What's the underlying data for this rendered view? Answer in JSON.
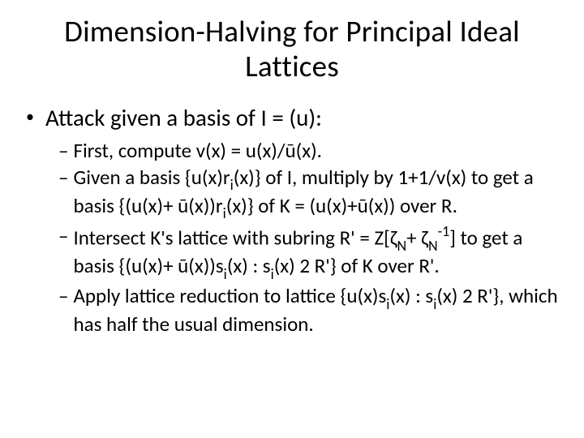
{
  "title": "Dimension-Halving for Principal Ideal Lattices",
  "bullet1_prefix": "Attack given a basis of I = (",
  "bullet1_u": "u",
  "bullet1_suffix": "):",
  "sub1_prefix": "First, compute v(x) = ",
  "sub1_mid": "u(x)/ū(x).",
  "sub2_a": "Given a basis {u(x)r",
  "sub2_b": "(x)} of I, multiply by 1+1/v(x) to get a basis {(u(x)+ ū(x))r",
  "sub2_c": "(x)} of K = (u(x)+ū(x)) over R.",
  "sub3_a": "Intersect K's lattice with subring R' = Z[ζ",
  "sub3_b": "+ ζ",
  "sub3_c": "] to get a basis {(u(x)+ ū(x))s",
  "sub3_d": "(x) : s",
  "sub3_e": "(x) ",
  "sub3_f": " R'} of K over R'.",
  "sub4_a": "Apply lattice reduction to lattice {u(x)s",
  "sub4_b": "(x) : s",
  "sub4_c": "(x) ",
  "sub4_d": " R'}, which has half the usual dimension.",
  "idx_i": "i",
  "idx_N": "N",
  "neg1": "-1",
  "elem": "2"
}
